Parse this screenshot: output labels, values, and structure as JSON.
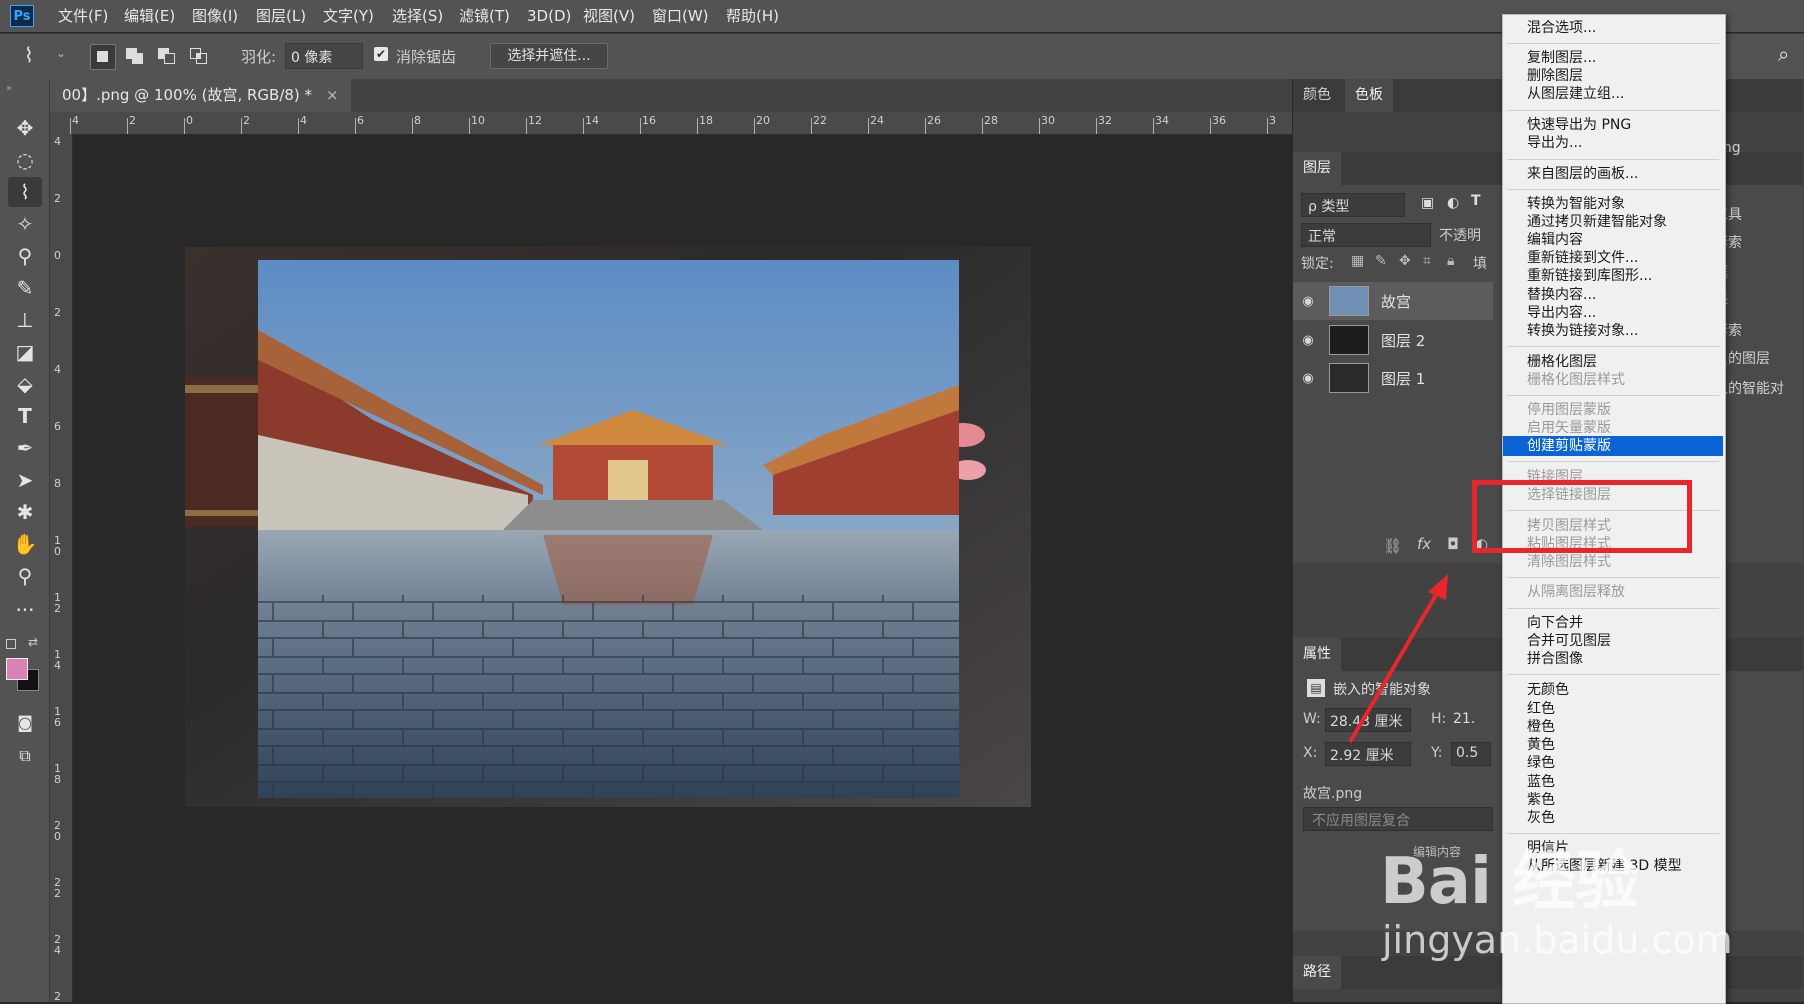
{
  "app": {
    "logo": "Ps"
  },
  "menubar": {
    "items": [
      "文件(F)",
      "编辑(E)",
      "图像(I)",
      "图层(L)",
      "文字(Y)",
      "选择(S)",
      "滤镜(T)",
      "3D(D)",
      "视图(V)",
      "窗口(W)",
      "帮助(H)"
    ]
  },
  "options": {
    "feather_label": "羽化:",
    "feather_value": "0 像素",
    "antialias_label": "消除锯齿",
    "select_mask_button": "选择并遮住..."
  },
  "document": {
    "tab_title": "00】.png @ 100% (故宫, RGB/8) *",
    "close": "×",
    "hruler_labels": [
      "4",
      "2",
      "0",
      "2",
      "4",
      "6",
      "8",
      "10",
      "12",
      "14",
      "16",
      "18",
      "20",
      "22",
      "24",
      "26",
      "28",
      "30",
      "32",
      "34",
      "36",
      "3"
    ],
    "vruler_labels": [
      "4",
      "2",
      "0",
      "2",
      "4",
      "6",
      "8",
      "1\n0",
      "1\n2",
      "1\n4",
      "1\n6",
      "1\n8",
      "2\n0",
      "2\n2",
      "2\n4",
      "2"
    ]
  },
  "panels": {
    "swatches_tabs": [
      "颜色",
      "色板"
    ],
    "layers_tab": "图层",
    "filter_kind": "ρ 类型",
    "blend_mode": "正常",
    "opacity_label": "不透明",
    "lock_label": "锁定:",
    "fill_label": "填",
    "layers": [
      {
        "name": "故宫"
      },
      {
        "name": "图层 2"
      },
      {
        "name": "图层 1"
      }
    ],
    "properties_tab": "属性",
    "properties_type": "嵌入的智能对象",
    "w_label": "W:",
    "w_value": "28.43 厘米",
    "h_label": "H:",
    "h_value": "21.",
    "x_label": "X:",
    "x_value": "2.92 厘米",
    "y_label": "Y:",
    "y_value": "0.5",
    "filename": "故宫.png",
    "layer_comp": "不应用图层复合",
    "edit_contents": "编辑内容",
    "paths_tab": "路径",
    "side_strip": [
      "png",
      "工具",
      "套索",
      "框",
      "择",
      "套索",
      "贝的图层",
      "入的智能对"
    ]
  },
  "context_menu": {
    "items": [
      {
        "label": "混合选项...",
        "disabled": false
      },
      {
        "label": "复制图层...",
        "disabled": false
      },
      {
        "label": "删除图层",
        "disabled": false
      },
      {
        "label": "从图层建立组...",
        "disabled": false
      },
      {
        "label": "快速导出为 PNG",
        "disabled": false
      },
      {
        "label": "导出为...",
        "disabled": false
      },
      {
        "label": "来自图层的画板...",
        "disabled": false
      },
      {
        "label": "转换为智能对象",
        "disabled": false
      },
      {
        "label": "通过拷贝新建智能对象",
        "disabled": false
      },
      {
        "label": "编辑内容",
        "disabled": false
      },
      {
        "label": "重新链接到文件...",
        "disabled": false
      },
      {
        "label": "重新链接到库图形...",
        "disabled": false
      },
      {
        "label": "替换内容...",
        "disabled": false
      },
      {
        "label": "导出内容...",
        "disabled": false
      },
      {
        "label": "转换为链接对象...",
        "disabled": false
      },
      {
        "label": "栅格化图层",
        "disabled": false
      },
      {
        "label": "栅格化图层样式",
        "disabled": true
      },
      {
        "label": "停用图层蒙版",
        "disabled": true
      },
      {
        "label": "启用矢量蒙版",
        "disabled": true
      },
      {
        "label": "创建剪贴蒙版",
        "disabled": false,
        "selected": true
      },
      {
        "label": "链接图层",
        "disabled": true
      },
      {
        "label": "选择链接图层",
        "disabled": true
      },
      {
        "label": "拷贝图层样式",
        "disabled": true
      },
      {
        "label": "粘贴图层样式",
        "disabled": true
      },
      {
        "label": "清除图层样式",
        "disabled": true
      },
      {
        "label": "从隔离图层释放",
        "disabled": true
      },
      {
        "label": "向下合并",
        "disabled": false
      },
      {
        "label": "合并可见图层",
        "disabled": false
      },
      {
        "label": "拼合图像",
        "disabled": false
      },
      {
        "label": "无颜色",
        "disabled": false
      },
      {
        "label": "红色",
        "disabled": false
      },
      {
        "label": "橙色",
        "disabled": false
      },
      {
        "label": "黄色",
        "disabled": false
      },
      {
        "label": "绿色",
        "disabled": false
      },
      {
        "label": "蓝色",
        "disabled": false
      },
      {
        "label": "紫色",
        "disabled": false
      },
      {
        "label": "灰色",
        "disabled": false
      },
      {
        "label": "明信片",
        "disabled": false
      },
      {
        "label": "从所选图层新建 3D 模型",
        "disabled": false
      }
    ]
  },
  "watermark": {
    "line1": "Bai 经验",
    "line2": "jingyan.baidu.com"
  },
  "colors": {
    "foreground": "#d983b4",
    "background": "#111111",
    "menu_highlight": "#0a64d6",
    "annotation_red": "#e8262b"
  }
}
